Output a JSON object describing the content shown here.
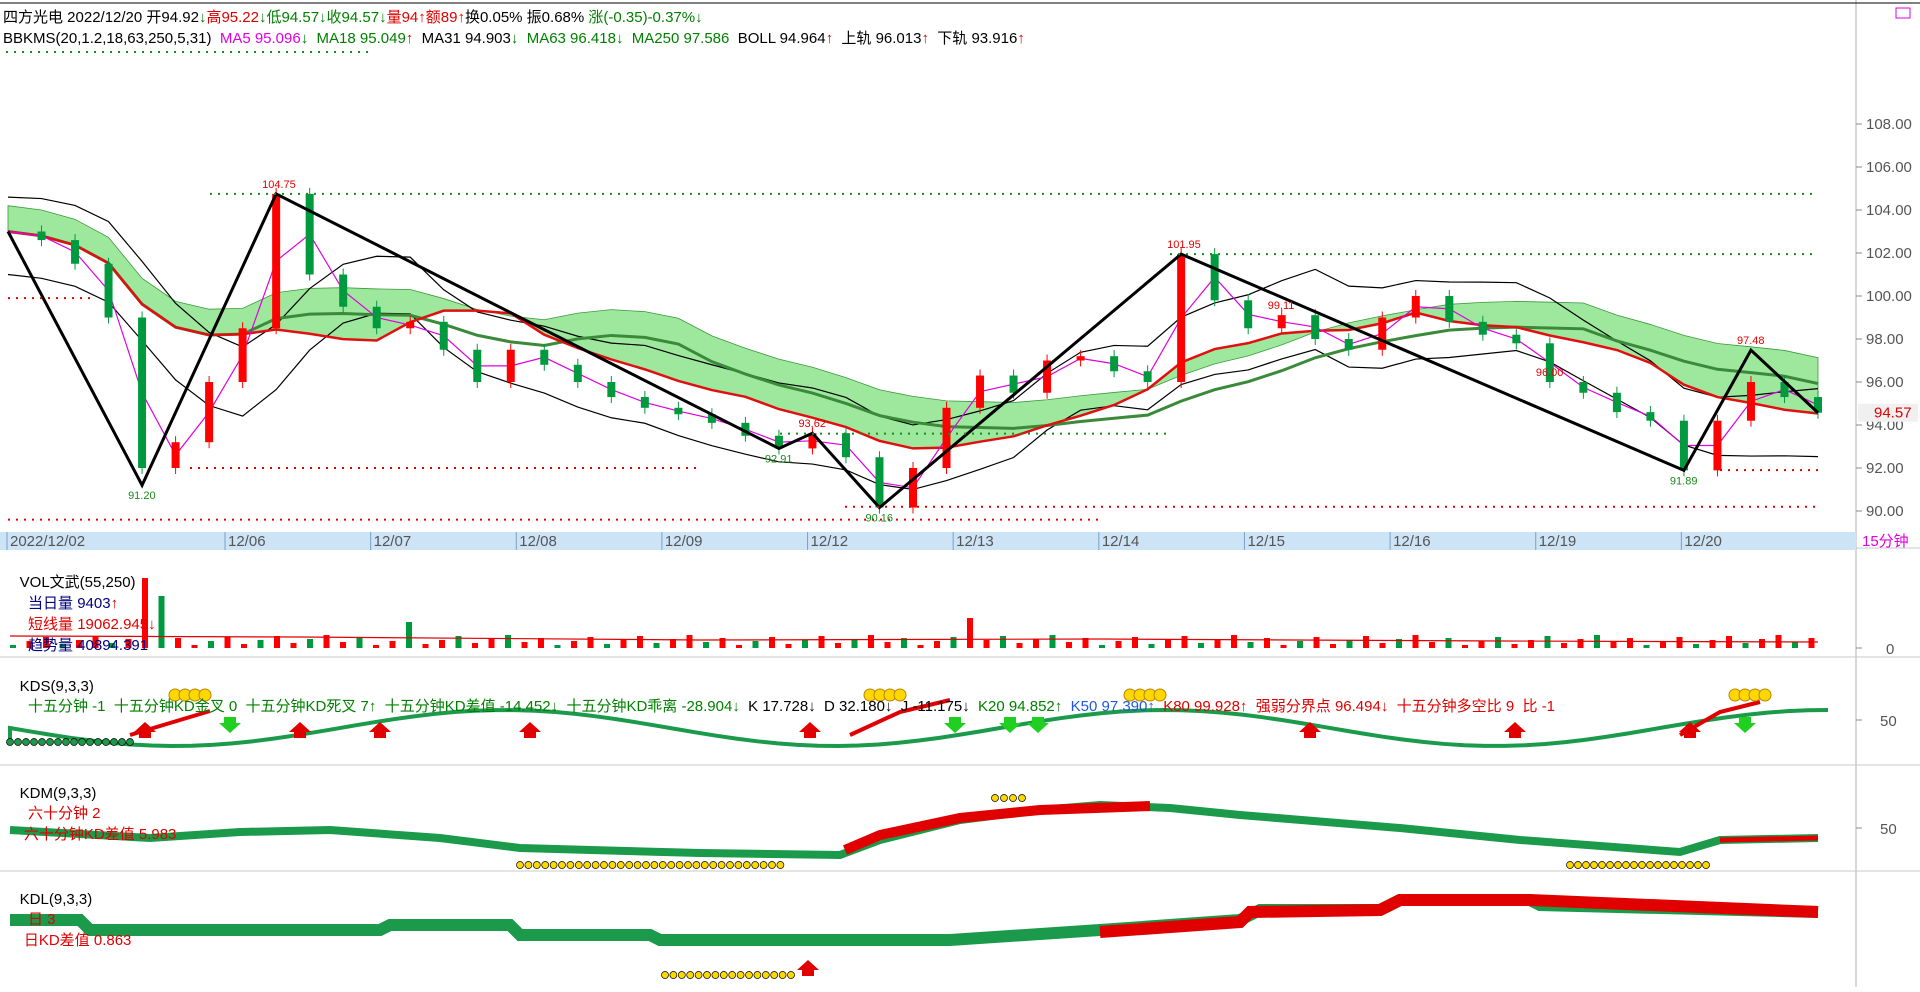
{
  "header": {
    "row1": [
      {
        "text": "四方光电 2022/12/20 开94.92",
        "color": "#000000"
      },
      {
        "text": "↓",
        "color": "#008000"
      },
      {
        "text": "高95.22",
        "color": "#e00000"
      },
      {
        "text": "↓",
        "color": "#008000"
      },
      {
        "text": "低94.57",
        "color": "#008000"
      },
      {
        "text": "↓",
        "color": "#008000"
      },
      {
        "text": "收94.57",
        "color": "#008000"
      },
      {
        "text": "↓",
        "color": "#008000"
      },
      {
        "text": "量94",
        "color": "#e00000"
      },
      {
        "text": "↑",
        "color": "#e00000"
      },
      {
        "text": "额89",
        "color": "#e00000"
      },
      {
        "text": "↑",
        "color": "#e00000"
      },
      {
        "text": "换0.05%",
        "color": "#000000"
      },
      {
        "text": " 振0.68%",
        "color": "#000000"
      },
      {
        "text": " 涨(-0.35)-0.37%",
        "color": "#008000"
      },
      {
        "text": "↓",
        "color": "#008000"
      }
    ],
    "row2": [
      {
        "text": "BBKMS(20,1.2,18,63,250,5,31)",
        "color": "#000000"
      },
      {
        "text": "  MA5 95.096",
        "color": "#e000e0"
      },
      {
        "text": "↓",
        "color": "#008000"
      },
      {
        "text": "  MA18 95.049",
        "color": "#008000"
      },
      {
        "text": "↑",
        "color": "#e00000"
      },
      {
        "text": "  MA31 94.903",
        "color": "#000000"
      },
      {
        "text": "↓",
        "color": "#008000"
      },
      {
        "text": "  MA63 96.418",
        "color": "#008000"
      },
      {
        "text": "↓",
        "color": "#008000"
      },
      {
        "text": "  MA250 97.586",
        "color": "#008000"
      },
      {
        "text": "  BOLL 94.964",
        "color": "#000000"
      },
      {
        "text": "↑",
        "color": "#e00000"
      },
      {
        "text": "  上轨 96.013",
        "color": "#000000"
      },
      {
        "text": "↑",
        "color": "#e00000"
      },
      {
        "text": "  下轨 93.916",
        "color": "#000000"
      },
      {
        "text": "↑",
        "color": "#e00000"
      }
    ]
  },
  "chart_data": {
    "type": "candlestick",
    "price_axis": {
      "ticks": [
        "108.00",
        "106.00",
        "104.00",
        "102.00",
        "100.00",
        "98.00",
        "96.00",
        "94.00",
        "92.00",
        "90.00"
      ],
      "current": "94.57"
    },
    "date_axis": [
      "2022/12/02",
      "12/06",
      "12/07",
      "12/08",
      "12/09",
      "12/12",
      "12/13",
      "12/14",
      "12/15",
      "12/16",
      "12/19",
      "12/20"
    ],
    "period": "15分钟",
    "annotations": [
      "104.75",
      "91.20",
      "92.91",
      "93.62",
      "90.16",
      "101.95",
      "99.11",
      "96.00",
      "97.48",
      "91.89"
    ],
    "price_path": [
      103.0,
      102.6,
      101.5,
      99.0,
      92.0,
      93.2,
      96.0,
      98.5,
      104.75,
      101.0,
      99.5,
      98.5,
      98.8,
      97.5,
      96.0,
      97.5,
      96.8,
      96.0,
      95.3,
      94.8,
      94.5,
      94.1,
      93.5,
      92.91,
      93.62,
      92.5,
      90.16,
      92.0,
      94.8,
      96.3,
      95.5,
      97.0,
      97.2,
      96.5,
      96.0,
      101.95,
      99.8,
      98.5,
      99.11,
      98.0,
      97.5,
      99.0,
      100.0,
      98.8,
      98.2,
      97.8,
      96.0,
      95.5,
      94.6,
      94.2,
      91.89,
      94.2,
      96.0,
      95.3,
      94.57
    ],
    "volume": {
      "title": "VOL文武(55,250)",
      "day_vol": "9403",
      "short_vol": "19062.945",
      "trend_vol": "40894.391",
      "axis_zero": "0"
    },
    "kds": {
      "title": "KDS(9,3,3)",
      "items": [
        "十五分钟 -1",
        "十五分钟KD金叉 0",
        "十五分钟KD死叉 7",
        "十五分钟KD差值 -14.452",
        "十五分钟KD乖离 -28.904",
        "K 17.728",
        "D 32.180",
        "J -11.175",
        "K20 94.852",
        "K50 97.390",
        "K80 99.928",
        "强弱分界点 96.494",
        "十五分钟多空比 9",
        "比 -1"
      ],
      "axis": "50"
    },
    "kdm": {
      "title": "KDM(9,3,3)",
      "items": [
        "六十分钟 2",
        "六十分钟KD差值 5.983"
      ],
      "axis": "50"
    },
    "kdl": {
      "title": "KDL(9,3,3)",
      "items": [
        "日 3",
        "日KD差值 0.863"
      ]
    }
  },
  "colors": {
    "up": "#ff0000",
    "down": "#009a3e",
    "band_green": "#7ee07e",
    "band_cyan": "#a8ecec",
    "axis_bg": "#cde3f6"
  }
}
